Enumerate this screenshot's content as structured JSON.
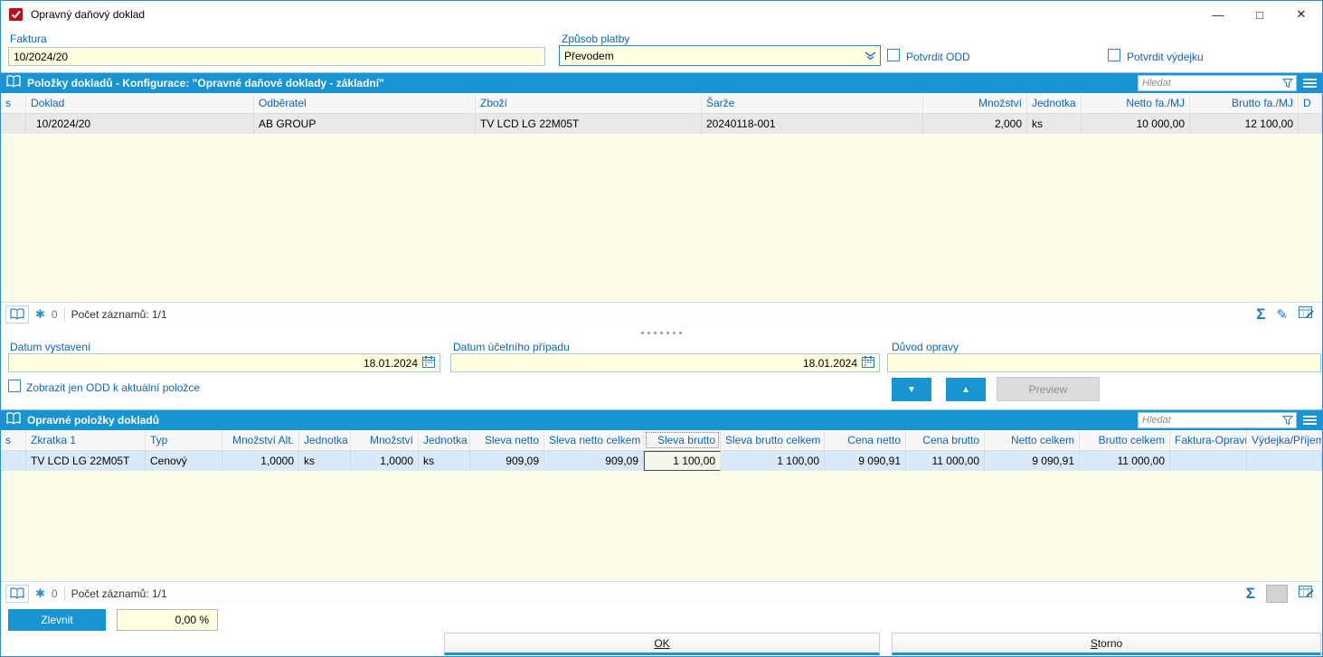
{
  "window": {
    "title": "Opravný daňový doklad",
    "minimize": "—",
    "maximize": "□",
    "close": "✕"
  },
  "icons": {
    "snowflake": "✱",
    "sigma": "Σ",
    "pencil": "✎",
    "arrow_down": "▼",
    "arrow_up": "▲"
  },
  "colors": {
    "accent_blue": "#1794d1",
    "label_blue": "#0a64c4",
    "field_bg": "#ffffe1",
    "grid_bg": "#fcfce8",
    "selected_row": "#d8eafa"
  },
  "top": {
    "faktura_label": "Faktura",
    "faktura_value": "10/2024/20",
    "platba_label": "Způsob platby",
    "platba_value": "Převodem",
    "potvrdit_odd": "Potvrdit ODD",
    "potvrdit_vydejku": "Potvrdit výdejku"
  },
  "grid1": {
    "title": "Položky dokladů - Konfigurace: \"Opravné daňové doklady - základní\"",
    "search_placeholder": "Hledat",
    "columns": [
      "s",
      "Doklad",
      "Odběratel",
      "Zboží",
      "Šarže",
      "Množství",
      "Jednotka",
      "Netto fa./MJ",
      "Brutto fa./MJ",
      "D"
    ],
    "row": [
      "",
      "10/2024/20",
      "AB GROUP",
      "TV LCD LG 22M05T",
      "20240118-001",
      "2,000",
      "ks",
      "10 000,00",
      "12 100,00",
      ""
    ],
    "status": {
      "frozen_count": "0",
      "records": "Počet záznamů: 1/1"
    }
  },
  "middle": {
    "datum_vystaveni_label": "Datum vystavení",
    "datum_vystaveni_value": "18.01.2024",
    "datum_ucetniho_label": "Datum účetního případu",
    "datum_ucetniho_value": "18.01.2024",
    "duvod_label": "Důvod opravy",
    "duvod_value": "",
    "zobrazit_checkbox": "Zobrazit jen ODD k aktuální položce",
    "preview_label": "Preview"
  },
  "grid2": {
    "title": "Opravné položky dokladů",
    "search_placeholder": "Hledat",
    "columns": [
      "s",
      "Zkratka 1",
      "Typ",
      "Množství Alt.",
      "Jednotka",
      "Množství",
      "Jednotka",
      "Sleva netto",
      "Sleva netto celkem",
      "Sleva brutto",
      "Sleva brutto celkem",
      "Cena netto",
      "Cena brutto",
      "Netto celkem",
      "Brutto celkem",
      "Faktura-Opravr",
      "Výdejka/Příjem"
    ],
    "row": [
      "",
      "TV LCD LG 22M05T",
      "Cenový",
      "1,0000",
      "ks",
      "1,0000",
      "ks",
      "909,09",
      "909,09",
      "1 100,00",
      "1 100,00",
      "9 090,91",
      "11 000,00",
      "9 090,91",
      "11 000,00",
      "",
      ""
    ],
    "status": {
      "frozen_count": "0",
      "records": "Počet záznamů: 1/1"
    }
  },
  "footer": {
    "zlevnit_label": "Zlevnit",
    "percent_value": "0,00 %",
    "ok_label": "OK",
    "storno_label": "Storno"
  }
}
